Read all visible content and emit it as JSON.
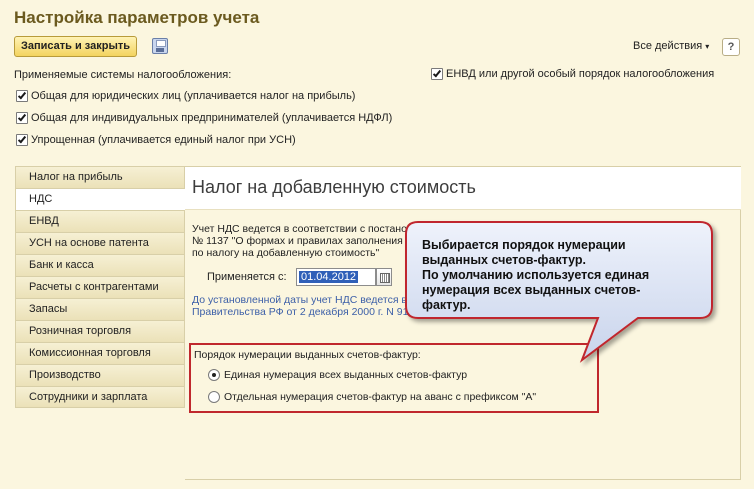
{
  "window": {
    "title": "Настройка параметров учета"
  },
  "toolbar": {
    "save_close_label": "Записать и закрыть",
    "save_icon": "floppy-disk-icon",
    "actions_label": "Все действия",
    "actions_caret": "▾",
    "help_label": "?"
  },
  "tax_systems": {
    "label": "Применяемые системы налогообложения:",
    "items": [
      {
        "label": "Общая для юридических лиц (уплачивается налог на прибыль)",
        "checked": true
      },
      {
        "label": "Общая для индивидуальных предпринимателей (уплачивается НДФЛ)",
        "checked": true
      },
      {
        "label": "Упрощенная (уплачивается единый налог при УСН)",
        "checked": true
      }
    ],
    "envd": {
      "label": "ЕНВД или другой особый порядок налогообложения",
      "checked": true
    }
  },
  "tabs": [
    {
      "label": "Налог на прибыль"
    },
    {
      "label": "НДС",
      "active": true
    },
    {
      "label": "ЕНВД"
    },
    {
      "label": "УСН на основе патента"
    },
    {
      "label": "Банк и касса"
    },
    {
      "label": "Расчеты с контрагентами"
    },
    {
      "label": "Запасы"
    },
    {
      "label": "Розничная торговля"
    },
    {
      "label": "Комиссионная торговля"
    },
    {
      "label": "Производство"
    },
    {
      "label": "Сотрудники и зарплата"
    }
  ],
  "vat": {
    "heading": "Налог на добавленную стоимость",
    "desc_line1": "Учет НДС ведется в соответствии с постановлением Правительства РФ от 26 декабря 2011",
    "desc_line2": "№ 1137 \"О формах и правилах заполнения (ведения) документов, применяемых при расчетах",
    "desc_line3": "по налогу на добавленную стоимость\"",
    "applied_label": "Применяется с:",
    "applied_date": "01.04.2012",
    "link_line1": "До установленной даты учет НДС ведется в соответствии с Постановлением",
    "link_line2": "Правительства РФ от 2 декабря 2000 г. N 914",
    "numbering_label": "Порядок нумерации выданных счетов-фактур:",
    "numbering_options": [
      {
        "label": "Единая нумерация всех выданных счетов-фактур",
        "selected": true
      },
      {
        "label": "Отдельная нумерация счетов-фактур на аванс с префиксом \"А\"",
        "selected": false
      }
    ]
  },
  "callout": {
    "line1": "Выбирается порядок нумерации",
    "line2": "выданных счетов-фактур.",
    "line3": "По умолчанию используется единая",
    "line4": "нумерация всех выданных счетов-",
    "line5": "фактур."
  },
  "colors": {
    "title": "#6b5a1f",
    "accent_button": "#f3d35f",
    "highlight_border": "#c0282d",
    "link": "#3c5fa8"
  }
}
